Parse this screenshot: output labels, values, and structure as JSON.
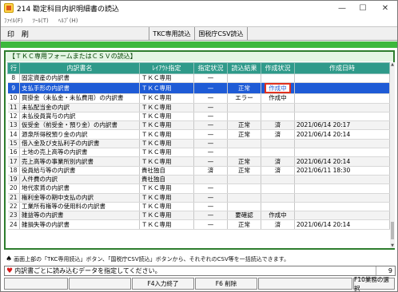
{
  "window": {
    "title": "214 勘定科目内訳明細書の読込",
    "controls": {
      "minimize": "—",
      "maximize": "☐",
      "close": "✕"
    }
  },
  "menu": {
    "items": [
      "ﾌｧｲﾙ(F)",
      "ﾂｰﾙ(T)",
      "ﾍﾙﾌﾟ(H)"
    ]
  },
  "toolbar": {
    "print_label": "印 刷",
    "tkc_read_label": "TKC専用読込",
    "nta_csv_label": "国税庁CSV読込"
  },
  "panel": {
    "title": "【ＴＫＣ専用フォームまたはＣＳＶの読込】"
  },
  "table": {
    "headers": [
      "行",
      "内訳書名",
      "ﾚｲｱｳﾄ指定",
      "指定状況",
      "読込結果",
      "作成状況",
      "作成日時"
    ],
    "rows": [
      {
        "no": "8",
        "name": "固定資産の内訳書",
        "layout": "ＴＫＣ専用",
        "spec": "—",
        "result": "",
        "status": "",
        "date": ""
      },
      {
        "no": "9",
        "name": "支払手形の内訳書",
        "layout": "ＴＫＣ専用",
        "spec": "—",
        "result": "正常",
        "status": "作成中",
        "date": ""
      },
      {
        "no": "10",
        "name": "買掛金（未払金・未払費用）の内訳書",
        "layout": "ＴＫＣ専用",
        "spec": "—",
        "result": "エラー",
        "status": "作成中",
        "date": ""
      },
      {
        "no": "11",
        "name": "未払配当金の内訳",
        "layout": "ＴＫＣ専用",
        "spec": "—",
        "result": "",
        "status": "",
        "date": ""
      },
      {
        "no": "12",
        "name": "未払役員賞与の内訳",
        "layout": "ＴＫＣ専用",
        "spec": "—",
        "result": "",
        "status": "",
        "date": ""
      },
      {
        "no": "13",
        "name": "仮受金（前受金・預り金）の内訳書",
        "layout": "ＴＫＣ専用",
        "spec": "—",
        "result": "正常",
        "status": "済",
        "date": "2021/06/14 20:17"
      },
      {
        "no": "14",
        "name": "源泉所得税預り金の内訳",
        "layout": "ＴＫＣ専用",
        "spec": "—",
        "result": "正常",
        "status": "済",
        "date": "2021/06/14 20:14"
      },
      {
        "no": "15",
        "name": "借入金及び支払利子の内訳書",
        "layout": "ＴＫＣ専用",
        "spec": "—",
        "result": "",
        "status": "",
        "date": ""
      },
      {
        "no": "16",
        "name": "土地の売上高等の内訳書",
        "layout": "ＴＫＣ専用",
        "spec": "—",
        "result": "",
        "status": "",
        "date": ""
      },
      {
        "no": "17",
        "name": "売上高等の事業所別内訳書",
        "layout": "ＴＫＣ専用",
        "spec": "—",
        "result": "正常",
        "status": "済",
        "date": "2021/06/14 20:14"
      },
      {
        "no": "18",
        "name": "役員給与等の内訳書",
        "layout": "貴社独自",
        "spec": "済",
        "result": "正常",
        "status": "済",
        "date": "2021/06/11 18:30"
      },
      {
        "no": "19",
        "name": "人件費の内訳",
        "layout": "貴社独自",
        "spec": "",
        "result": "",
        "status": "",
        "date": ""
      },
      {
        "no": "20",
        "name": "地代家賃の内訳書",
        "layout": "ＴＫＣ専用",
        "spec": "—",
        "result": "",
        "status": "",
        "date": ""
      },
      {
        "no": "21",
        "name": "権利金等の期中支払の内訳",
        "layout": "ＴＫＣ専用",
        "spec": "—",
        "result": "",
        "status": "",
        "date": ""
      },
      {
        "no": "22",
        "name": "工業所有権等の使用料の内訳書",
        "layout": "ＴＫＣ専用",
        "spec": "—",
        "result": "",
        "status": "",
        "date": ""
      },
      {
        "no": "23",
        "name": "雑益等の内訳書",
        "layout": "ＴＫＣ専用",
        "spec": "—",
        "result": "要確認",
        "status": "作成中",
        "date": ""
      },
      {
        "no": "24",
        "name": "雑損失等の内訳書",
        "layout": "ＴＫＣ専用",
        "spec": "—",
        "result": "正常",
        "status": "済",
        "date": "2021/06/14 20:14"
      }
    ],
    "selected_row": "9"
  },
  "info": {
    "text": "画面上部の「TKC専用読込」ボタン、「国税庁CSV読込」ボタンから、それぞれのCSV等を一括読込できます。"
  },
  "prompt": {
    "text": "内訳書ごとに読み込むデータを指定してください。",
    "value": "9"
  },
  "fkeys": {
    "f4": "F4入力終了",
    "f6": "F6 削除",
    "f10": "F10業務の選択"
  },
  "colors": {
    "header_teal": "#2f9a8a",
    "selection_blue": "#1e5bd6",
    "panel_green": "#2e7d2e",
    "highlight_red": "#e0301e"
  }
}
